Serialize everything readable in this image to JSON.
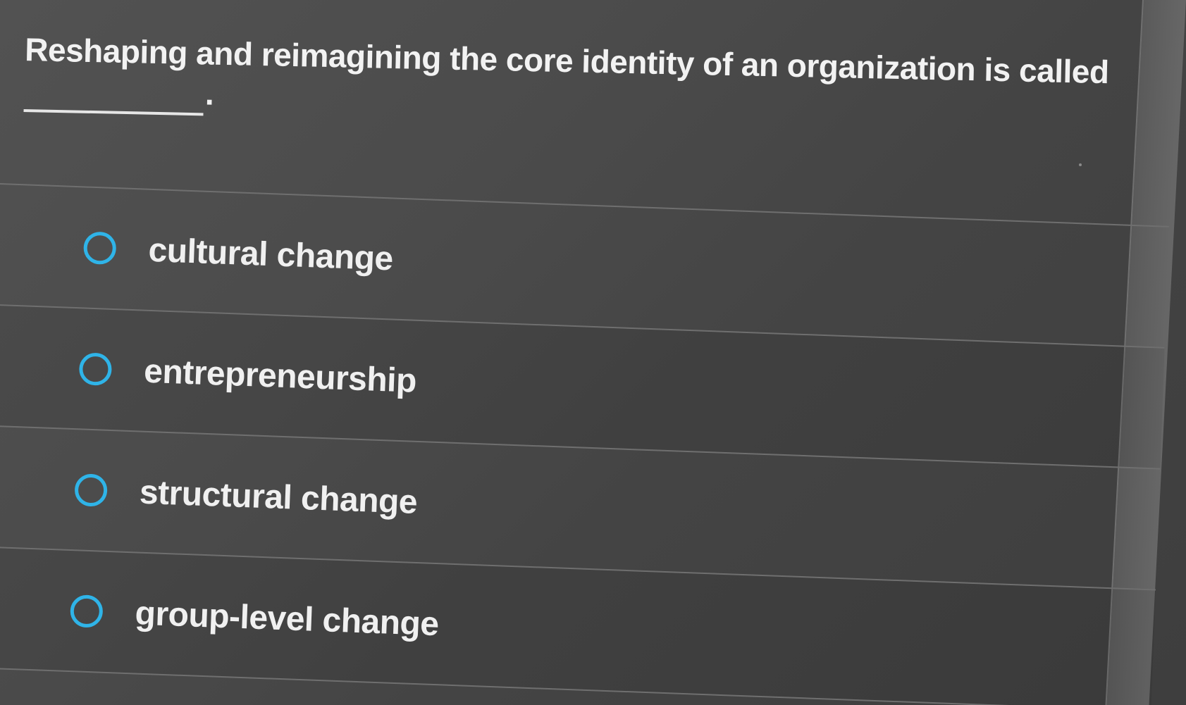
{
  "question": {
    "text": "Reshaping and reimagining the core identity of an organization is called",
    "period": "."
  },
  "options": [
    {
      "label": "cultural change",
      "selected": false
    },
    {
      "label": "entrepreneurship",
      "selected": false
    },
    {
      "label": "structural change",
      "selected": false
    },
    {
      "label": "group-level change",
      "selected": false
    }
  ],
  "colors": {
    "radio_accent": "#2fb4e8",
    "text": "#f0f0f0",
    "background": "#4a4a4a"
  }
}
